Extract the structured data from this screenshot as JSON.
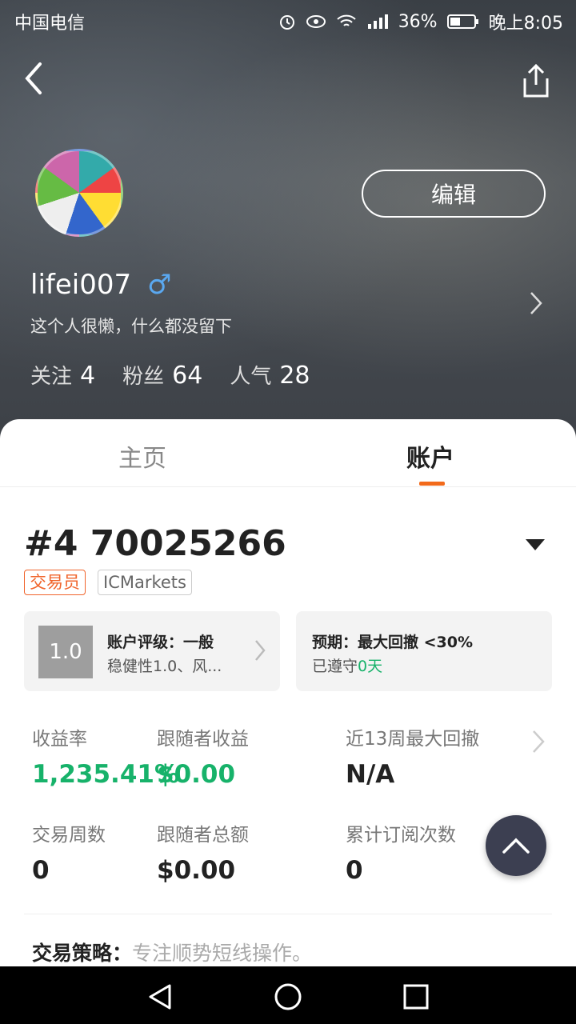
{
  "status_bar": {
    "carrier": "中国电信",
    "battery": "36%",
    "time": "晚上8:05"
  },
  "profile": {
    "edit_label": "编辑",
    "username": "lifei007",
    "gender_symbol": "♂",
    "bio": "这个人很懒，什么都没留下",
    "stats": [
      {
        "label": "关注",
        "value": "4"
      },
      {
        "label": "粉丝",
        "value": "64"
      },
      {
        "label": "人气",
        "value": "28"
      }
    ]
  },
  "tabs": {
    "home": "主页",
    "account": "账户"
  },
  "account": {
    "number": "#4 70025266",
    "tags": [
      "交易员",
      "ICMarkets"
    ],
    "rating": {
      "score": "1.0",
      "title": "账户评级：一般",
      "subtitle": "稳健性1.0、风..."
    },
    "expectation": {
      "title": "预期：最大回撤 <30%",
      "subtitle_prefix": "已遵守",
      "days": "0天"
    },
    "metrics": [
      {
        "label": "收益率",
        "value": "1,235.41%"
      },
      {
        "label": "跟随者收益",
        "value": "$0.00"
      },
      {
        "label": "近13周最大回撤",
        "value": "N/A"
      },
      {
        "label": "交易周数",
        "value": "0"
      },
      {
        "label": "跟随者总额",
        "value": "$0.00"
      },
      {
        "label": "累计订阅次数",
        "value": "0"
      }
    ],
    "strategy": {
      "label": "交易策略：",
      "value": "专注顺势短线操作。"
    }
  },
  "colors": {
    "accent_orange": "#f26a1b",
    "positive_green": "#17b26a",
    "fab_bg": "#3c3f51"
  }
}
